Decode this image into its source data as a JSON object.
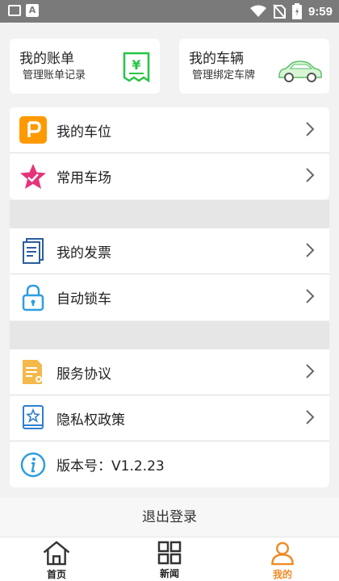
{
  "status_bar": {
    "time": "9:59",
    "notification_icons": [
      "image-icon",
      "a-icon"
    ],
    "system_icons": [
      "wifi-icon",
      "no-sim-icon",
      "battery-icon"
    ]
  },
  "cards": [
    {
      "title": "我的账单",
      "subtitle": "管理账单记录",
      "icon": "bill-icon"
    },
    {
      "title": "我的车辆",
      "subtitle": "管理绑定车牌",
      "icon": "car-icon"
    }
  ],
  "group1": [
    {
      "label": "我的车位",
      "icon": "parking-icon"
    },
    {
      "label": "常用车场",
      "icon": "star-badge-icon"
    }
  ],
  "group2": [
    {
      "label": "我的发票",
      "icon": "invoice-icon"
    },
    {
      "label": "自动锁车",
      "icon": "lock-icon"
    }
  ],
  "group3": [
    {
      "label": "服务协议",
      "icon": "document-icon"
    },
    {
      "label": "隐私权政策",
      "icon": "privacy-book-icon"
    },
    {
      "label": "版本号：V1.2.23",
      "icon": "info-icon"
    }
  ],
  "logout_label": "退出登录",
  "tabs": [
    {
      "label": "首页",
      "icon": "home-icon",
      "active": false
    },
    {
      "label": "新闻",
      "icon": "grid-icon",
      "active": false
    },
    {
      "label": "我的",
      "icon": "user-icon",
      "active": true
    }
  ],
  "colors": {
    "accent": "#f08a24",
    "green": "#27c447",
    "parking_orange": "#ff9900",
    "star_pink": "#e6347a",
    "blue": "#2f7fd0"
  }
}
